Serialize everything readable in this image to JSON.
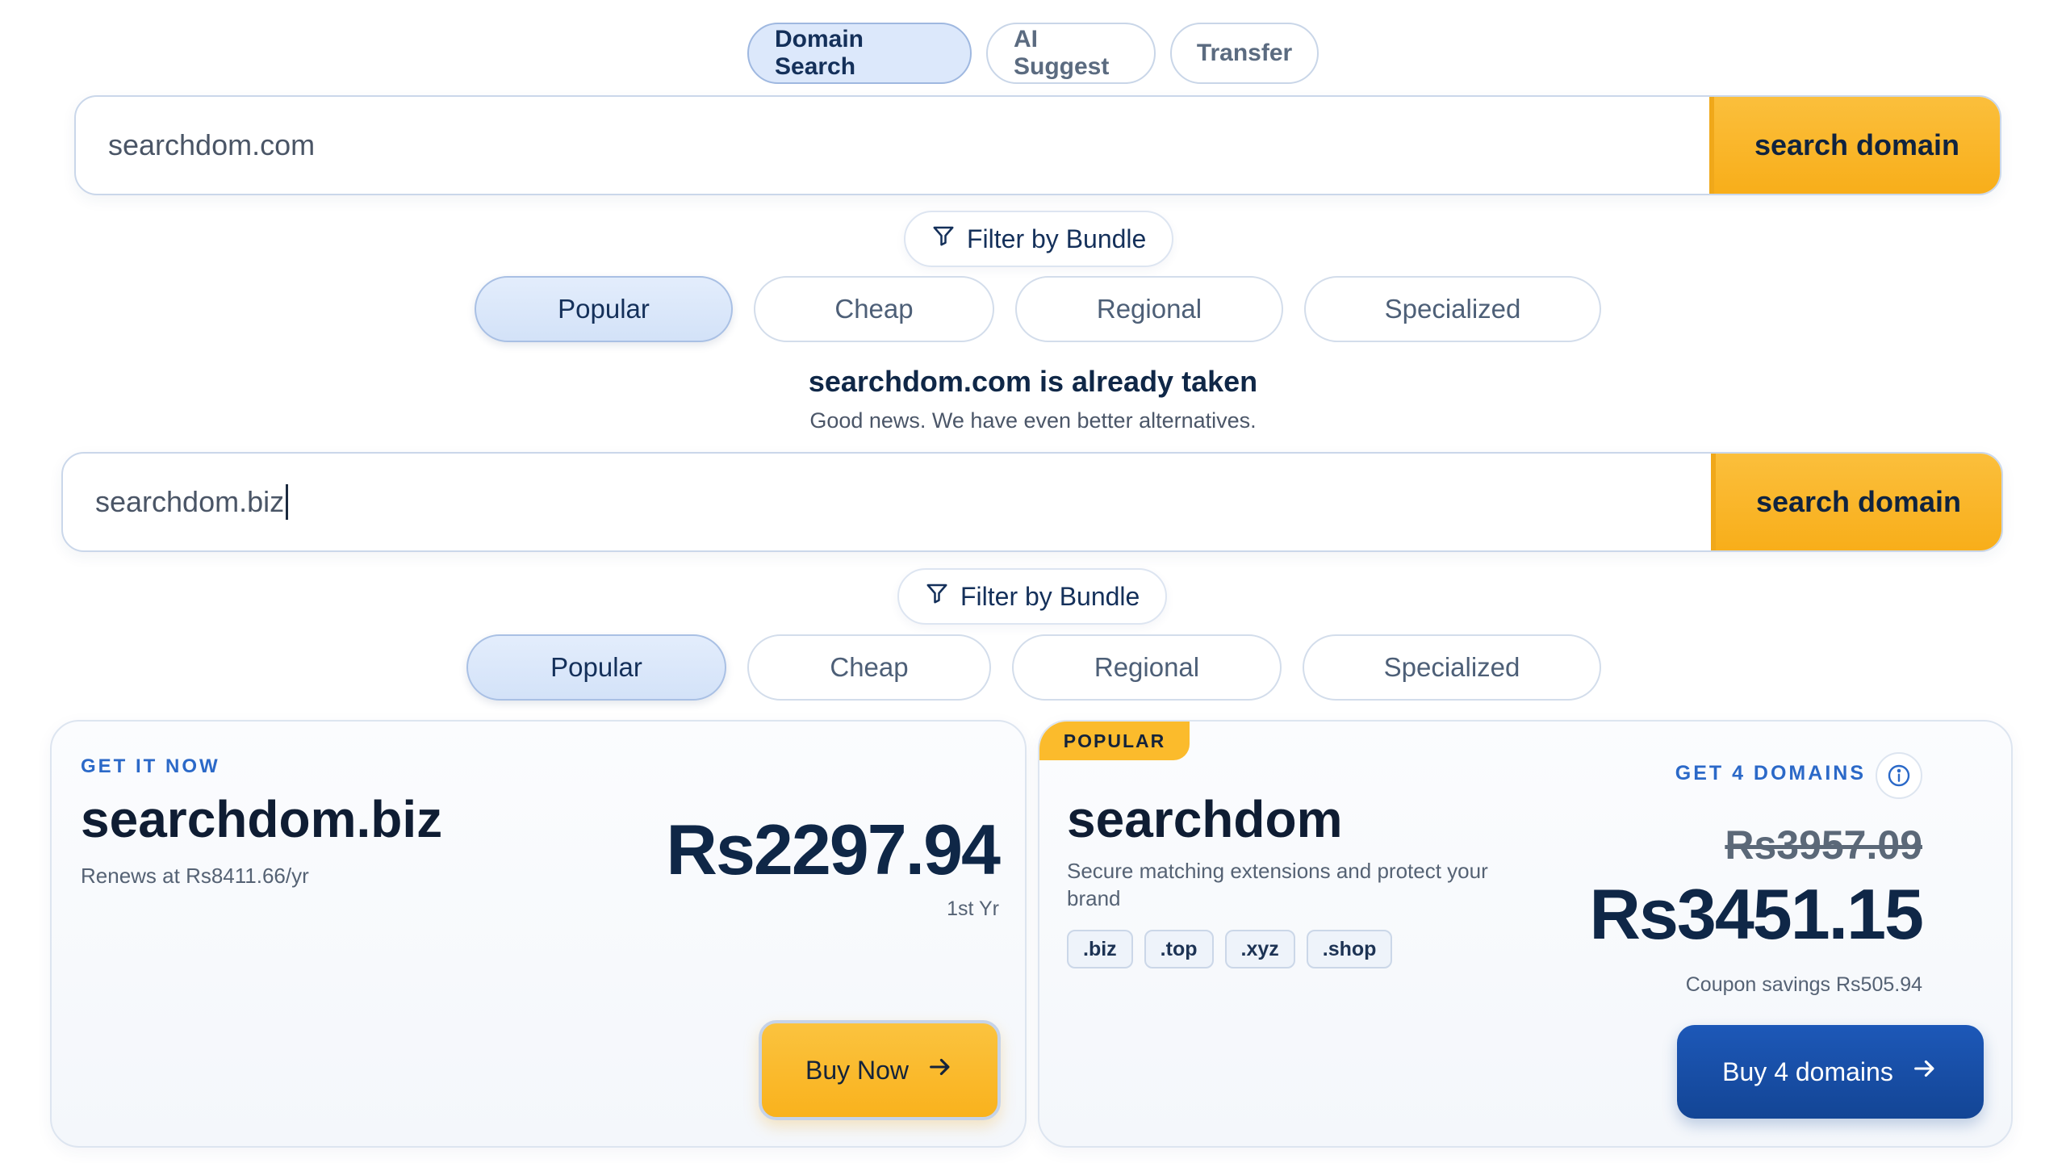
{
  "mode_tabs": {
    "domain_search": "Domain Search",
    "ai_suggest": "AI Suggest",
    "transfer": "Transfer"
  },
  "search1": {
    "value": "searchdom.com",
    "button": "search domain"
  },
  "filter_label": "Filter by Bundle",
  "bundles": [
    "Popular",
    "Cheap",
    "Regional",
    "Specialized"
  ],
  "result_msg": {
    "title": "searchdom.com is already taken",
    "subtitle": "Good news. We have even better alternatives."
  },
  "search2": {
    "value": "searchdom.biz",
    "button": "search domain"
  },
  "card_single": {
    "eyebrow": "GET IT NOW",
    "domain": "searchdom.biz",
    "renew": "Renews at Rs8411.66/yr",
    "price": "Rs2297.94",
    "term": "1st Yr",
    "button": "Buy Now"
  },
  "card_bundle": {
    "tag": "POPULAR",
    "eyebrow": "GET 4 DOMAINS",
    "name": "searchdom",
    "description": "Secure matching extensions and protect your brand",
    "extensions": [
      ".biz",
      ".top",
      ".xyz",
      ".shop"
    ],
    "old_price": "Rs3957.09",
    "price": "Rs3451.15",
    "coupon": "Coupon savings Rs505.94",
    "button": "Buy 4 domains"
  },
  "colors": {
    "accent_yellow": "#f9b21d",
    "accent_blue": "#1d58b8",
    "link_blue": "#2b69c8",
    "navy": "#0f2747"
  }
}
